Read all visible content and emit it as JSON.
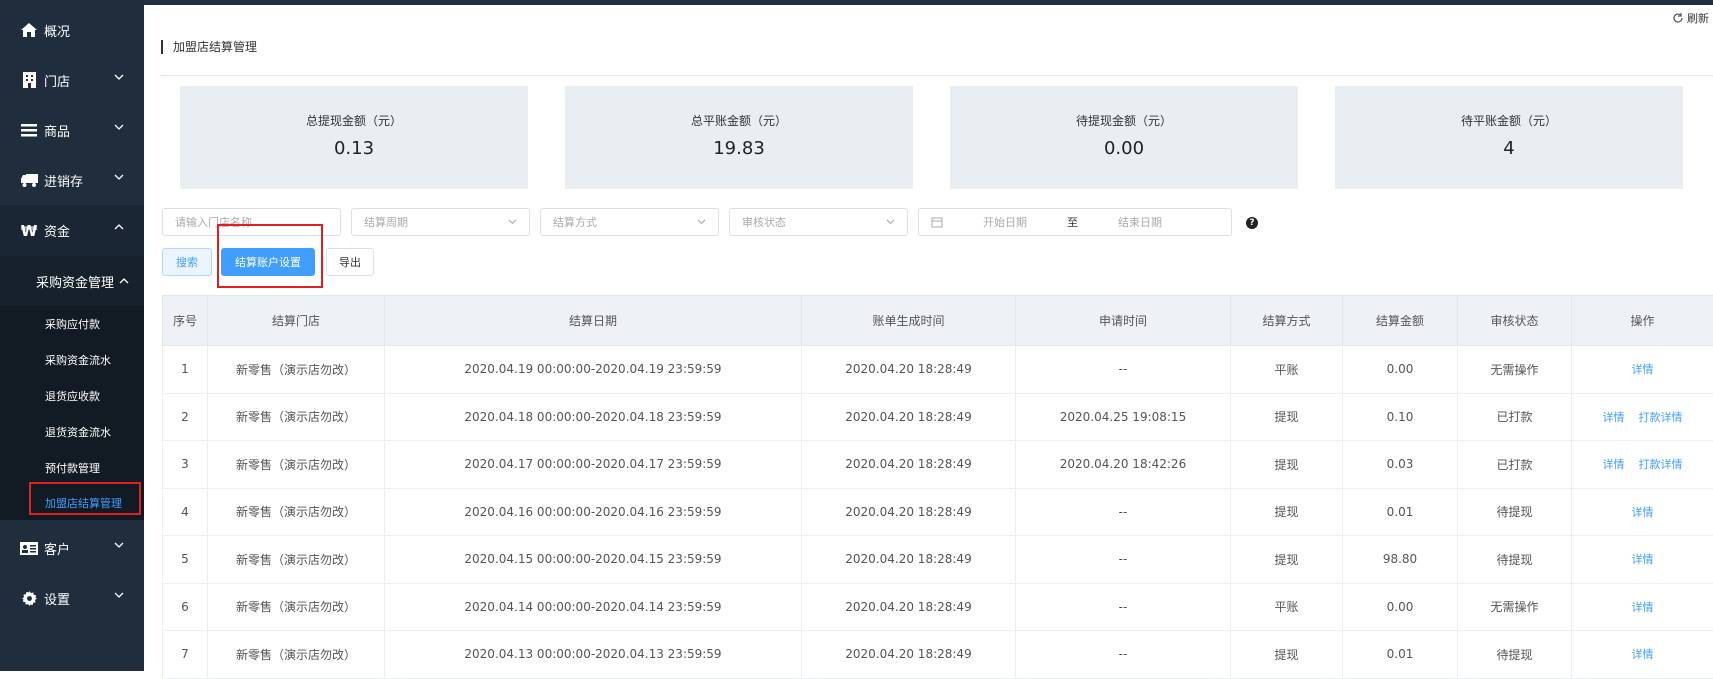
{
  "sidebar": {
    "items": [
      {
        "label": "概况",
        "icon": "home-icon"
      },
      {
        "label": "门店",
        "icon": "store-icon"
      },
      {
        "label": "商品",
        "icon": "list-icon"
      },
      {
        "label": "进销存",
        "icon": "truck-icon"
      },
      {
        "label": "资金",
        "icon": "yuan-icon"
      },
      {
        "label": "客户",
        "icon": "id-card-icon"
      },
      {
        "label": "设置",
        "icon": "gear-icon"
      }
    ],
    "submenu_title": "采购资金管理",
    "subitems": [
      "采购应付款",
      "采购资金流水",
      "退货应收款",
      "退货资金流水",
      "预付款管理",
      "加盟店结算管理"
    ]
  },
  "header": {
    "refresh_label": "刷新"
  },
  "page": {
    "title": "加盟店结算管理"
  },
  "stats": [
    {
      "label": "总提现金额（元）",
      "value": "0.13"
    },
    {
      "label": "总平账金额（元）",
      "value": "19.83"
    },
    {
      "label": "待提现金额（元）",
      "value": "0.00"
    },
    {
      "label": "待平账金额（元）",
      "value": "4"
    }
  ],
  "filters": {
    "store_placeholder": "请输入门店名称",
    "period_placeholder": "结算周期",
    "method_placeholder": "结算方式",
    "status_placeholder": "审核状态",
    "start_placeholder": "开始日期",
    "range_sep": "至",
    "end_placeholder": "结束日期"
  },
  "buttons": {
    "search": "搜索",
    "settle_account": "结算账户设置",
    "export": "导出"
  },
  "table": {
    "headers": [
      "序号",
      "结算门店",
      "结算日期",
      "账单生成时间",
      "申请时间",
      "结算方式",
      "结算金额",
      "审核状态",
      "操作"
    ],
    "rows": [
      {
        "no": "1",
        "store": "新零售（演示店勿改）",
        "date": "2020.04.19 00:00:00-2020.04.19 23:59:59",
        "gen": "2020.04.20 18:28:49",
        "apply": "--",
        "method": "平账",
        "amount": "0.00",
        "status": "无需操作",
        "ops": [
          "详情"
        ]
      },
      {
        "no": "2",
        "store": "新零售（演示店勿改）",
        "date": "2020.04.18 00:00:00-2020.04.18 23:59:59",
        "gen": "2020.04.20 18:28:49",
        "apply": "2020.04.25 19:08:15",
        "method": "提现",
        "amount": "0.10",
        "status": "已打款",
        "ops": [
          "详情",
          "打款详情"
        ]
      },
      {
        "no": "3",
        "store": "新零售（演示店勿改）",
        "date": "2020.04.17 00:00:00-2020.04.17 23:59:59",
        "gen": "2020.04.20 18:28:49",
        "apply": "2020.04.20 18:42:26",
        "method": "提现",
        "amount": "0.03",
        "status": "已打款",
        "ops": [
          "详情",
          "打款详情"
        ]
      },
      {
        "no": "4",
        "store": "新零售（演示店勿改）",
        "date": "2020.04.16 00:00:00-2020.04.16 23:59:59",
        "gen": "2020.04.20 18:28:49",
        "apply": "--",
        "method": "提现",
        "amount": "0.01",
        "status": "待提现",
        "ops": [
          "详情"
        ]
      },
      {
        "no": "5",
        "store": "新零售（演示店勿改）",
        "date": "2020.04.15 00:00:00-2020.04.15 23:59:59",
        "gen": "2020.04.20 18:28:49",
        "apply": "--",
        "method": "提现",
        "amount": "98.80",
        "status": "待提现",
        "ops": [
          "详情"
        ]
      },
      {
        "no": "6",
        "store": "新零售（演示店勿改）",
        "date": "2020.04.14 00:00:00-2020.04.14 23:59:59",
        "gen": "2020.04.20 18:28:49",
        "apply": "--",
        "method": "平账",
        "amount": "0.00",
        "status": "无需操作",
        "ops": [
          "详情"
        ]
      },
      {
        "no": "7",
        "store": "新零售（演示店勿改）",
        "date": "2020.04.13 00:00:00-2020.04.13 23:59:59",
        "gen": "2020.04.20 18:28:49",
        "apply": "--",
        "method": "提现",
        "amount": "0.01",
        "status": "待提现",
        "ops": [
          "详情"
        ]
      }
    ]
  }
}
